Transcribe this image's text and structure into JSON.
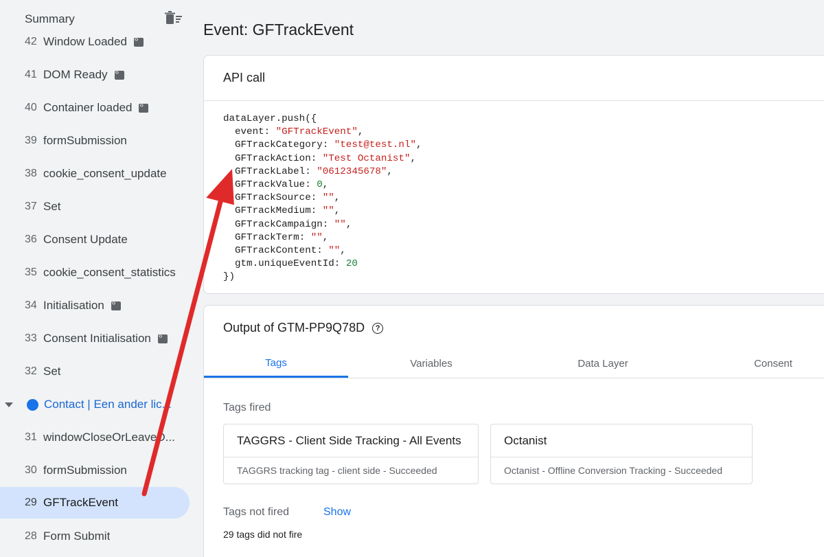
{
  "sidebar": {
    "title": "Summary",
    "clear_icon": "clear-all-icon",
    "items": [
      {
        "num": "42",
        "label": "Window Loaded",
        "has_tag": true
      },
      {
        "num": "41",
        "label": "DOM Ready",
        "has_tag": true
      },
      {
        "num": "40",
        "label": "Container loaded",
        "has_tag": true
      },
      {
        "num": "39",
        "label": "formSubmission",
        "has_tag": false
      },
      {
        "num": "38",
        "label": "cookie_consent_update",
        "has_tag": false
      },
      {
        "num": "37",
        "label": "Set",
        "has_tag": false
      },
      {
        "num": "36",
        "label": "Consent Update",
        "has_tag": false
      },
      {
        "num": "35",
        "label": "cookie_consent_statistics",
        "has_tag": false
      },
      {
        "num": "34",
        "label": "Initialisation",
        "has_tag": true
      },
      {
        "num": "33",
        "label": "Consent Initialisation",
        "has_tag": true
      },
      {
        "num": "32",
        "label": "Set",
        "has_tag": false
      }
    ],
    "group": {
      "label": "Contact | Een ander lic..."
    },
    "items2": [
      {
        "num": "31",
        "label": "windowCloseOrLeaveD..."
      },
      {
        "num": "30",
        "label": "formSubmission"
      },
      {
        "num": "29",
        "label": "GFTrackEvent"
      },
      {
        "num": "28",
        "label": "Form Submit"
      }
    ]
  },
  "main": {
    "title": "Event: GFTrackEvent",
    "api_card": {
      "title": "API call",
      "code": {
        "open": "dataLayer.push({",
        "lines": [
          {
            "key": "event",
            "value": "\"GFTrackEvent\"",
            "kind": "s"
          },
          {
            "key": "GFTrackCategory",
            "value": "\"test@test.nl\"",
            "kind": "s"
          },
          {
            "key": "GFTrackAction",
            "value": "\"Test Octanist\"",
            "kind": "s"
          },
          {
            "key": "GFTrackLabel",
            "value": "\"0612345678\"",
            "kind": "s"
          },
          {
            "key": "GFTrackValue",
            "value": "0",
            "kind": "n"
          },
          {
            "key": "GFTrackSource",
            "value": "\"\"",
            "kind": "s"
          },
          {
            "key": "GFTrackMedium",
            "value": "\"\"",
            "kind": "s"
          },
          {
            "key": "GFTrackCampaign",
            "value": "\"\"",
            "kind": "s"
          },
          {
            "key": "GFTrackTerm",
            "value": "\"\"",
            "kind": "s"
          },
          {
            "key": "GFTrackContent",
            "value": "\"\"",
            "kind": "s"
          },
          {
            "key": "gtm.uniqueEventId",
            "value": "20",
            "kind": "n"
          }
        ],
        "close": "})"
      }
    },
    "output_card": {
      "title": "Output of GTM-PP9Q78D",
      "tabs": [
        "Tags",
        "Variables",
        "Data Layer",
        "Consent"
      ],
      "active_tab": "Tags",
      "tags_fired_label": "Tags fired",
      "tags": [
        {
          "title": "TAGGRS - Client Side Tracking - All Events",
          "subtitle": "TAGGRS tracking tag - client side - Succeeded"
        },
        {
          "title": "Octanist",
          "subtitle": "Octanist - Offline Conversion Tracking - Succeeded"
        }
      ],
      "tags_not_fired_label": "Tags not fired",
      "show_label": "Show",
      "not_fired_count_text": "29 tags did not fire"
    }
  },
  "colors": {
    "accent": "#1a73e8",
    "selected_bg": "#d3e3fd",
    "string": "#c5221f",
    "number": "#188038",
    "annotation_arrow": "#e02a2a"
  }
}
